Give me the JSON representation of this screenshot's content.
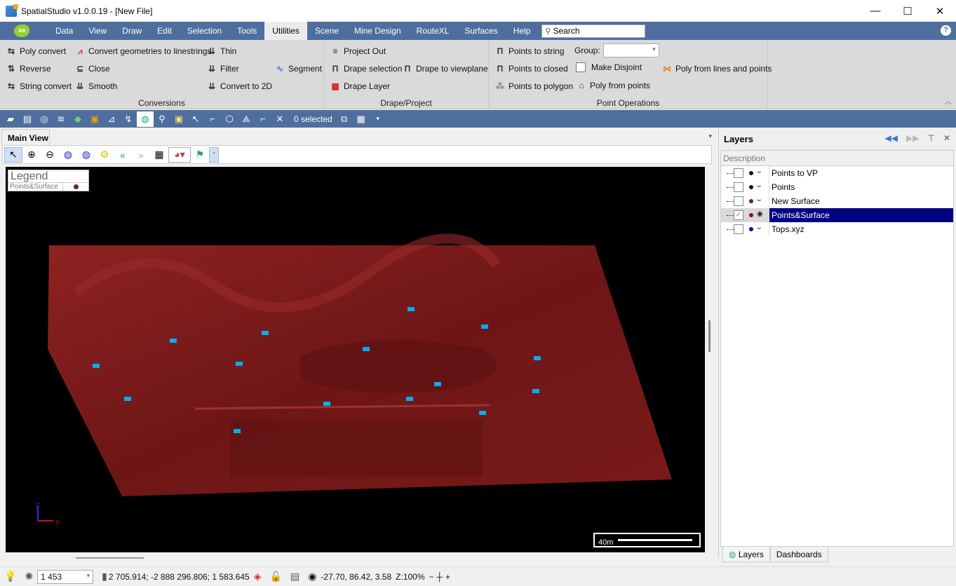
{
  "window": {
    "title": "SpatialStudio v1.0.0.19 - [New File]",
    "controls": {
      "minimize": "—",
      "maximize": "☐",
      "close": "✕"
    }
  },
  "menubar": {
    "logo_text": "AB",
    "items": [
      "Data",
      "View",
      "Draw",
      "Edit",
      "Selection",
      "Tools",
      "Utilities",
      "Scene",
      "Mine Design",
      "RouteXL",
      "Surfaces",
      "Help"
    ],
    "active": "Utilities",
    "search_placeholder": "Search",
    "help_label": "?"
  },
  "ribbon": {
    "groups": [
      {
        "label": "Conversions",
        "items": [
          {
            "label": "Poly convert",
            "icon": "poly-convert-icon"
          },
          {
            "label": "Reverse",
            "icon": "reverse-icon"
          },
          {
            "label": "String convert",
            "icon": "string-convert-icon"
          },
          {
            "label": "Convert geometries to linestrings",
            "icon": "convert-linestrings-icon"
          },
          {
            "label": "Close",
            "icon": "close-string-icon"
          },
          {
            "label": "Smooth",
            "icon": "smooth-icon"
          },
          {
            "label": "Thin",
            "icon": "thin-icon"
          },
          {
            "label": "Filter",
            "icon": "filter-icon"
          },
          {
            "label": "Convert to 2D",
            "icon": "convert-2d-icon"
          },
          {
            "label": "Segment",
            "icon": "segment-icon"
          }
        ]
      },
      {
        "label": "Drape/Project",
        "items": [
          {
            "label": "Project Out",
            "icon": "project-out-icon"
          },
          {
            "label": "Drape selection",
            "icon": "drape-selection-icon"
          },
          {
            "label": "Drape Layer",
            "icon": "drape-layer-icon"
          },
          {
            "label": "Drape to viewplane",
            "icon": "drape-viewplane-icon"
          }
        ]
      },
      {
        "label": "Point Operations",
        "items": [
          {
            "label": "Points to string",
            "icon": "points-string-icon"
          },
          {
            "label": "Points to closed",
            "icon": "points-closed-icon"
          },
          {
            "label": "Points to  polygon",
            "icon": "points-polygon-icon"
          },
          {
            "label": "Group:",
            "type": "combo",
            "value": ""
          },
          {
            "label": "Make Disjoint",
            "type": "checkbox",
            "checked": false
          },
          {
            "label": "Poly from points",
            "icon": "poly-from-points-icon"
          },
          {
            "label": "Poly from lines and points",
            "icon": "poly-lines-points-icon"
          }
        ]
      }
    ]
  },
  "toolbar": {
    "selected_count": "0 selected"
  },
  "document": {
    "tab": "Main View",
    "view_toolbar_extra": "*"
  },
  "viewport": {
    "legend": {
      "title": "Legend",
      "entries": [
        {
          "name": "Points&Surface",
          "color": "#8b1a1a"
        }
      ]
    },
    "scale_label": "40m",
    "axis": {
      "z": "Z",
      "x": "X"
    },
    "surface_color": "#7a1a1a",
    "point_color": "#00aeef"
  },
  "layers_panel": {
    "title": "Layers",
    "column": "Description",
    "layers": [
      {
        "name": "Points to VP",
        "checked": false,
        "visible": false,
        "dot": "#111111",
        "selected": false
      },
      {
        "name": "Points",
        "checked": false,
        "visible": false,
        "dot": "#111111",
        "selected": false
      },
      {
        "name": "New Surface",
        "checked": false,
        "visible": false,
        "dot": "#7a1a1a",
        "selected": false
      },
      {
        "name": "Points&Surface",
        "checked": true,
        "visible": true,
        "dot": "#7a1a1a",
        "selected": true
      },
      {
        "name": "Tops.xyz",
        "checked": false,
        "visible": false,
        "dot": "#0000cc",
        "selected": false
      }
    ],
    "tabs": [
      "Layers",
      "Dashboards"
    ]
  },
  "statusbar": {
    "zoom_value": "1 453",
    "cursor_coords": "2 705.914; -2 888 296.806; 1 583.645",
    "camera": "-27.70, 86.42, 3.58",
    "z_scale": "Z:100%"
  }
}
